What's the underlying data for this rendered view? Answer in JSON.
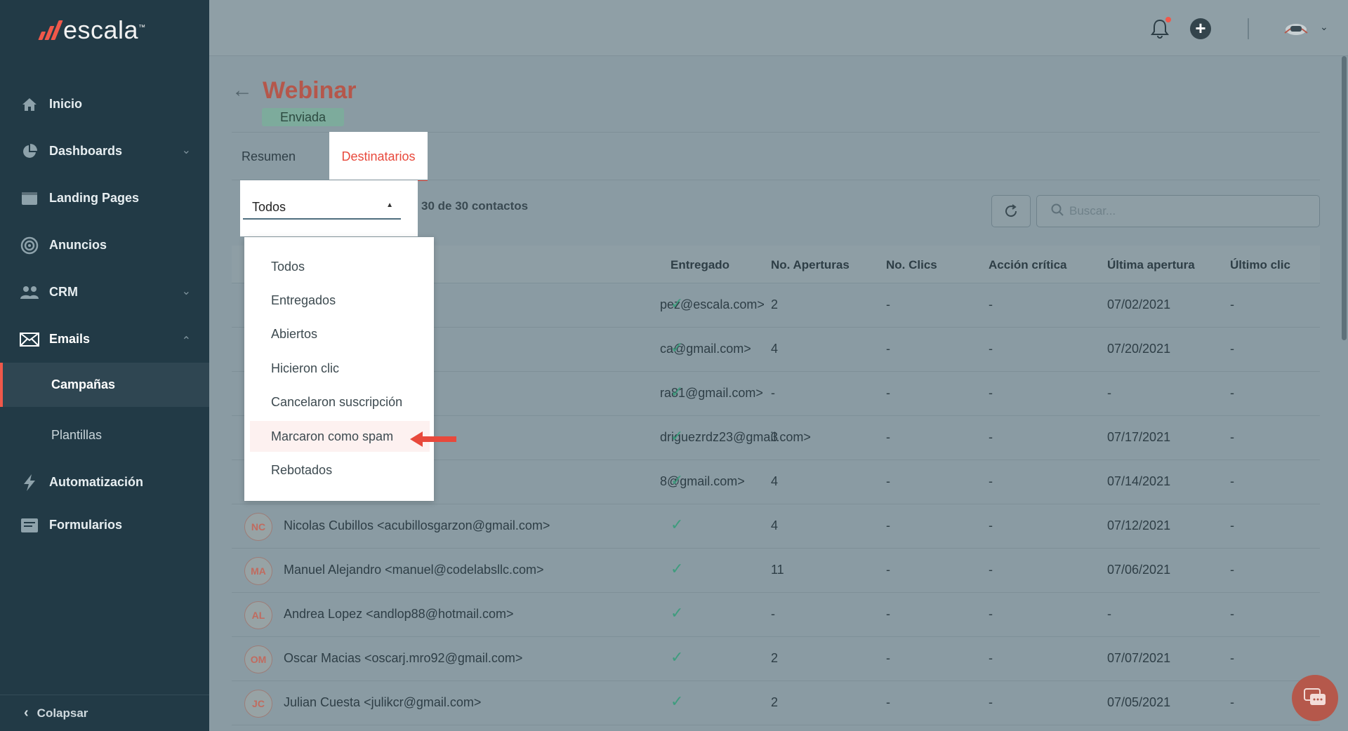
{
  "brand": {
    "name": "escala",
    "tm": "™"
  },
  "sidebar": {
    "items": [
      {
        "label": "Inicio",
        "icon": "home-icon"
      },
      {
        "label": "Dashboards",
        "icon": "pie-chart-icon"
      },
      {
        "label": "Landing Pages",
        "icon": "browser-window-icon"
      },
      {
        "label": "Anuncios",
        "icon": "target-icon"
      },
      {
        "label": "CRM",
        "icon": "people-icon"
      },
      {
        "label": "Emails",
        "icon": "envelope-icon"
      },
      {
        "label": "Automatización",
        "icon": "lightning-icon"
      },
      {
        "label": "Formularios",
        "icon": "form-icon"
      }
    ],
    "sub_items": [
      {
        "label": "Campañas"
      },
      {
        "label": "Plantillas"
      }
    ],
    "collapse_label": "Colapsar"
  },
  "page": {
    "title": "Webinar",
    "status": "Enviada",
    "tabs": [
      {
        "label": "Resumen"
      },
      {
        "label": "Destinatarios"
      }
    ],
    "filter_value": "Todos",
    "count_text": "30 de 30 contactos",
    "search_placeholder": "Buscar..."
  },
  "table": {
    "headers": [
      "Entregado",
      "No. Aperturas",
      "No. Clics",
      "Acción crítica",
      "Última apertura",
      "Último clic"
    ],
    "rows": [
      {
        "initials": "",
        "contact": "pez@escala.com>",
        "aperturas": "2",
        "clics": "-",
        "accion": "-",
        "ultima_apertura": "07/02/2021",
        "ultimo_clic": "-"
      },
      {
        "initials": "",
        "contact": "ca@gmail.com>",
        "aperturas": "4",
        "clics": "-",
        "accion": "-",
        "ultima_apertura": "07/20/2021",
        "ultimo_clic": "-"
      },
      {
        "initials": "",
        "contact": "ra81@gmail.com>",
        "aperturas": "-",
        "clics": "-",
        "accion": "-",
        "ultima_apertura": "-",
        "ultimo_clic": "-"
      },
      {
        "initials": "",
        "contact": "driguezrdz23@gmail.com>",
        "aperturas": "3",
        "clics": "-",
        "accion": "-",
        "ultima_apertura": "07/17/2021",
        "ultimo_clic": "-"
      },
      {
        "initials": "",
        "contact": "8@gmail.com>",
        "aperturas": "4",
        "clics": "-",
        "accion": "-",
        "ultima_apertura": "07/14/2021",
        "ultimo_clic": "-"
      },
      {
        "initials": "NC",
        "contact": "Nicolas Cubillos <acubillosgarzon@gmail.com>",
        "aperturas": "4",
        "clics": "-",
        "accion": "-",
        "ultima_apertura": "07/12/2021",
        "ultimo_clic": "-"
      },
      {
        "initials": "MA",
        "contact": "Manuel Alejandro <manuel@codelabsllc.com>",
        "aperturas": "11",
        "clics": "-",
        "accion": "-",
        "ultima_apertura": "07/06/2021",
        "ultimo_clic": "-"
      },
      {
        "initials": "AL",
        "contact": "Andrea Lopez <andlop88@hotmail.com>",
        "aperturas": "-",
        "clics": "-",
        "accion": "-",
        "ultima_apertura": "-",
        "ultimo_clic": "-"
      },
      {
        "initials": "OM",
        "contact": "Oscar Macias <oscarj.mro92@gmail.com>",
        "aperturas": "2",
        "clics": "-",
        "accion": "-",
        "ultima_apertura": "07/07/2021",
        "ultimo_clic": "-"
      },
      {
        "initials": "JC",
        "contact": "Julian Cuesta <julikcr@gmail.com>",
        "aperturas": "2",
        "clics": "-",
        "accion": "-",
        "ultima_apertura": "07/05/2021",
        "ultimo_clic": "-"
      }
    ]
  },
  "dropdown": {
    "options": [
      {
        "label": "Todos"
      },
      {
        "label": "Entregados"
      },
      {
        "label": "Abiertos"
      },
      {
        "label": "Hicieron clic"
      },
      {
        "label": "Cancelaron suscripción"
      },
      {
        "label": "Marcaron como spam"
      },
      {
        "label": "Rebotados"
      }
    ],
    "highlighted": "Marcaron como spam"
  },
  "colors": {
    "accent": "#e8493c",
    "sidebar_bg": "#223a46",
    "overlay_bg": "#8a9ba3",
    "check": "#3f9c7e"
  }
}
